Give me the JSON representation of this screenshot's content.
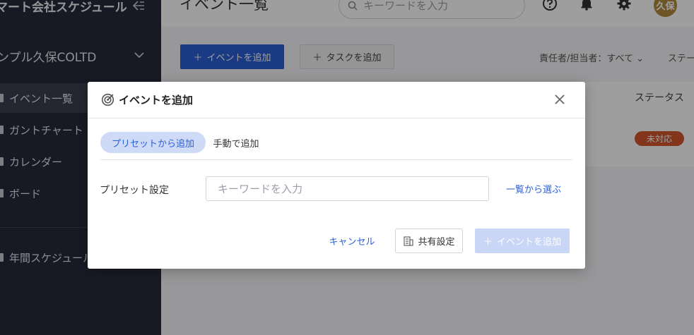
{
  "sidebar": {
    "app_title": "マート会社スケジュール",
    "company": "ンプル久保COLTD",
    "items": [
      {
        "label": "イベント一覧"
      },
      {
        "label": "ガントチャート"
      },
      {
        "label": "カレンダー"
      },
      {
        "label": "ボード"
      },
      {
        "label": "年間スケジュール"
      }
    ]
  },
  "header": {
    "page_title": "イベント一覧",
    "search_placeholder": "キーワードを入力",
    "avatar_text": "久保"
  },
  "toolbar": {
    "add_event_label": "イベントを追加",
    "add_task_label": "タスクを追加",
    "filter_assignee": "責任者/担当者：すべて",
    "filter_status_cut": "ステー"
  },
  "list": {
    "col_status": "ステータス",
    "badge_status": "未対応"
  },
  "modal": {
    "title": "イベントを追加",
    "tabs": [
      {
        "label": "プリセットから追加",
        "active": true
      },
      {
        "label": "手動で追加",
        "active": false
      }
    ],
    "field_label": "プリセット設定",
    "field_placeholder": "キーワードを入力",
    "pick_link": "一覧から選ぶ",
    "cancel_label": "キャンセル",
    "share_label": "共有設定",
    "submit_label": "イベントを追加"
  },
  "colors": {
    "accent": "#2b5fd6",
    "sidebar_bg": "#262a3a",
    "badge_bg": "#d2562c",
    "avatar_bg": "#b08a3e"
  }
}
